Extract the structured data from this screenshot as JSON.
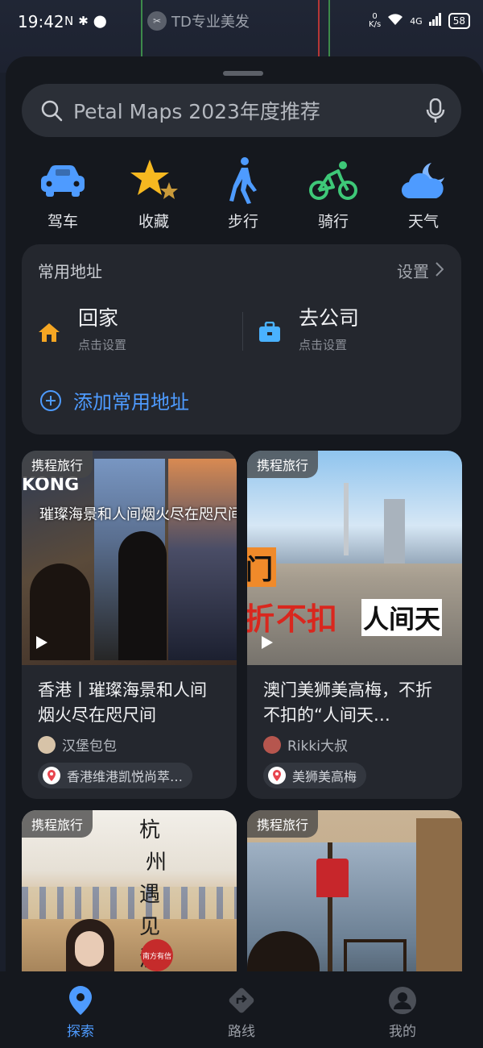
{
  "status_bar": {
    "time": "19:42",
    "notification_icons": [
      "N",
      "bluetooth",
      "location"
    ],
    "poi_label": "TD专业美发",
    "net_speed_value": "0",
    "net_speed_unit": "K/s",
    "network": "4G",
    "battery": "58"
  },
  "search": {
    "placeholder": "Petal Maps 2023年度推荐"
  },
  "quick_actions": [
    {
      "label": "驾车",
      "icon": "car-icon",
      "color": "#4e9bff"
    },
    {
      "label": "收藏",
      "icon": "star-icon",
      "color": "#f6b820"
    },
    {
      "label": "步行",
      "icon": "walk-icon",
      "color": "#4e9bff"
    },
    {
      "label": "骑行",
      "icon": "bicycle-icon",
      "color": "#3ec878"
    },
    {
      "label": "天气",
      "icon": "weather-icon",
      "color": "#4e9bff"
    }
  ],
  "addresses": {
    "title": "常用地址",
    "setting_label": "设置",
    "home": {
      "name": "回家",
      "sub": "点击设置"
    },
    "work": {
      "name": "去公司",
      "sub": "点击设置"
    },
    "add_label": "添加常用地址"
  },
  "feed": [
    {
      "tag": "携程旅行",
      "title": "香港丨璀璨海景和人间烟火尽在咫尺间",
      "author": "汉堡包包",
      "location": "香港维港凯悦尚萃…",
      "overlay": "璀璨海景和人间烟火尽在咫尺间",
      "overlay_top": "KONG"
    },
    {
      "tag": "携程旅行",
      "title": "澳门美狮美高梅，不折不扣的“人间天…",
      "author": "Rikki大叔",
      "location": "美狮美高梅",
      "overlay_big": "不扣",
      "overlay_side": "人间天",
      "overlay_left1": "门",
      "overlay_left2": "折"
    },
    {
      "tag": "携程旅行",
      "overlay_vertical": [
        "杭",
        "州",
        "遇",
        "见",
        "澳"
      ],
      "stamp": "南方有信"
    },
    {
      "tag": "携程旅行"
    }
  ],
  "tabbar": [
    {
      "label": "探索",
      "active": true
    },
    {
      "label": "路线",
      "active": false
    },
    {
      "label": "我的",
      "active": false
    }
  ],
  "colors": {
    "accent": "#4e9bff",
    "sheet": "#15181e",
    "card": "#24272e"
  }
}
